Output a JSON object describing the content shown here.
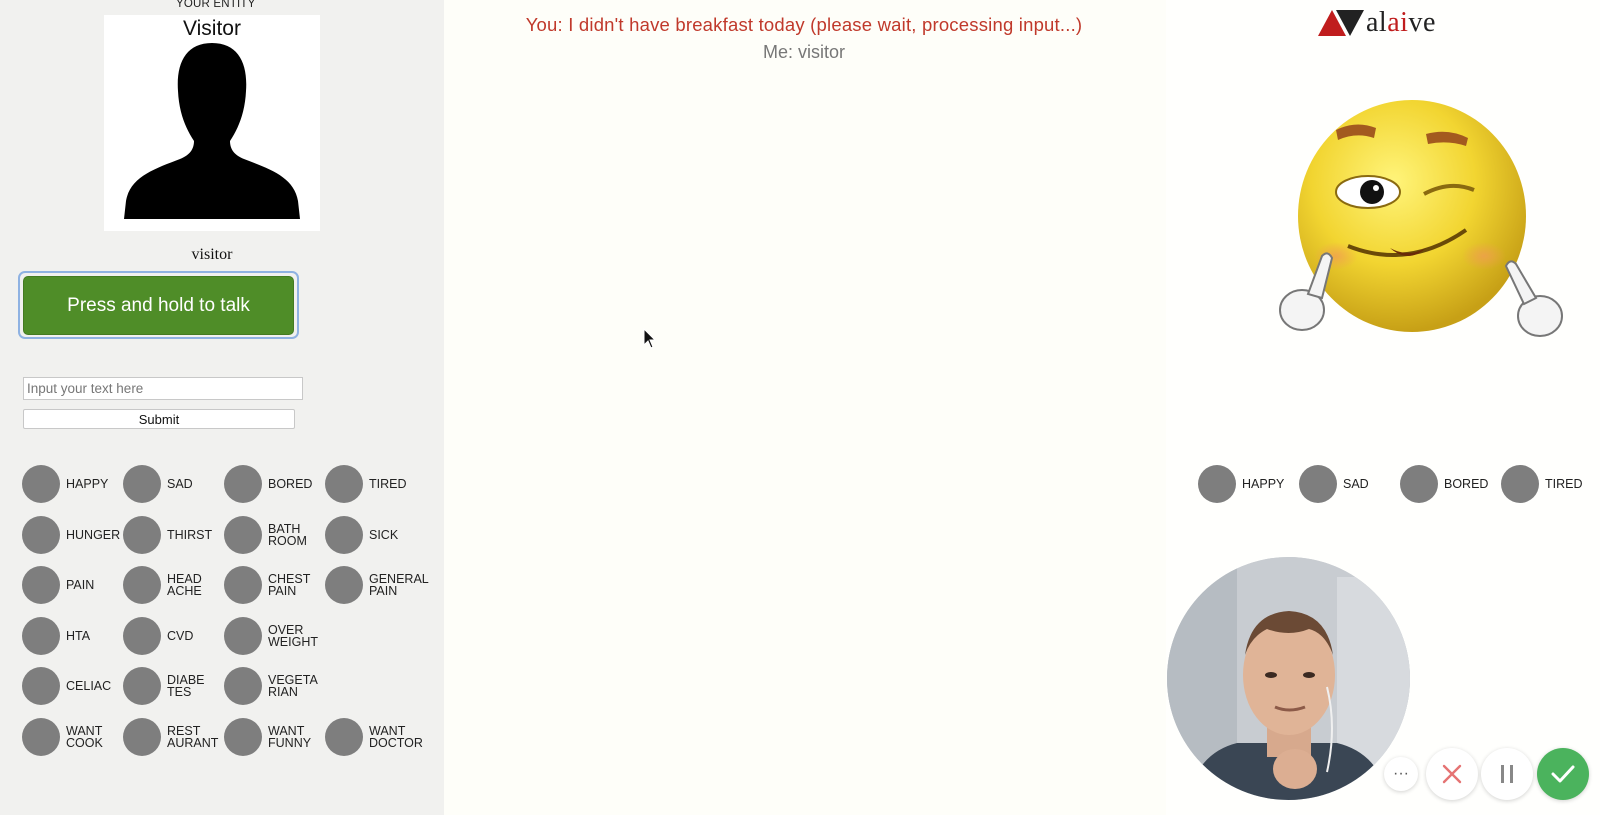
{
  "entity": {
    "heading": "YOUR ENTITY",
    "avatar_name": "Visitor",
    "name": "visitor"
  },
  "talk_button_label": "Press and hold to talk",
  "text_input": {
    "placeholder": "Input your text here",
    "value": ""
  },
  "submit_label": "Submit",
  "emotions_left": [
    "HAPPY",
    "SAD",
    "BORED",
    "TIRED",
    "HUNGER",
    "THIRST",
    "BATH\nROOM",
    "SICK",
    "PAIN",
    "HEAD\nACHE",
    "CHEST\nPAIN",
    "GENERAL\nPAIN",
    "HTA",
    "CVD",
    "OVER\nWEIGHT",
    "",
    "CELIAC",
    "DIABE\nTES",
    "VEGETA\nRIAN",
    "",
    "WANT\nCOOK",
    "REST\nAURANT",
    "WANT\nFUNNY",
    "WANT\nDOCTOR"
  ],
  "emotions_right": [
    "HAPPY",
    "SAD",
    "BORED",
    "TIRED"
  ],
  "conversation": {
    "you": "You: I didn't have breakfast today (please wait, processing input...)",
    "me": "Me: visitor"
  },
  "brand": {
    "prefix": "al",
    "accent": "ai",
    "suffix": "ve"
  },
  "video_controls": {
    "more": "···"
  },
  "colors": {
    "talk_button": "#4f8d28",
    "you_text": "#c0392b",
    "confirm_button": "#4bb35d",
    "cancel_icon": "#e57373",
    "emotion_circle": "#7e7e7e"
  }
}
